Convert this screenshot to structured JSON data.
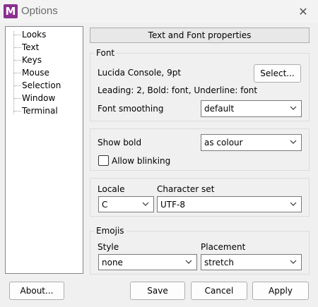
{
  "window": {
    "title": "Options",
    "app_icon": "M",
    "close_glyph": "✕"
  },
  "tree": {
    "items": [
      "Looks",
      "Text",
      "Keys",
      "Mouse",
      "Selection",
      "Window",
      "Terminal"
    ],
    "selected": "Text"
  },
  "header": {
    "label": "Text and Font properties"
  },
  "font_group": {
    "label": "Font",
    "font_name": "Lucida Console, 9pt",
    "select_button": "Select...",
    "details": "Leading: 2, Bold: font, Underline: font",
    "smoothing_label": "Font smoothing",
    "smoothing_value": "default"
  },
  "bold_group": {
    "show_bold_label": "Show bold",
    "show_bold_value": "as colour",
    "allow_blinking_label": "Allow blinking",
    "allow_blinking_checked": false
  },
  "locale_group": {
    "locale_label": "Locale",
    "locale_value": "C",
    "charset_label": "Character set",
    "charset_value": "UTF-8"
  },
  "emojis_group": {
    "label": "Emojis",
    "style_label": "Style",
    "style_value": "none",
    "placement_label": "Placement",
    "placement_value": "stretch"
  },
  "buttons": {
    "about": "About...",
    "save": "Save",
    "cancel": "Cancel",
    "apply": "Apply"
  },
  "colors": {
    "app_icon": "#8b2f8f",
    "window_bg": "#f0f0f0"
  }
}
